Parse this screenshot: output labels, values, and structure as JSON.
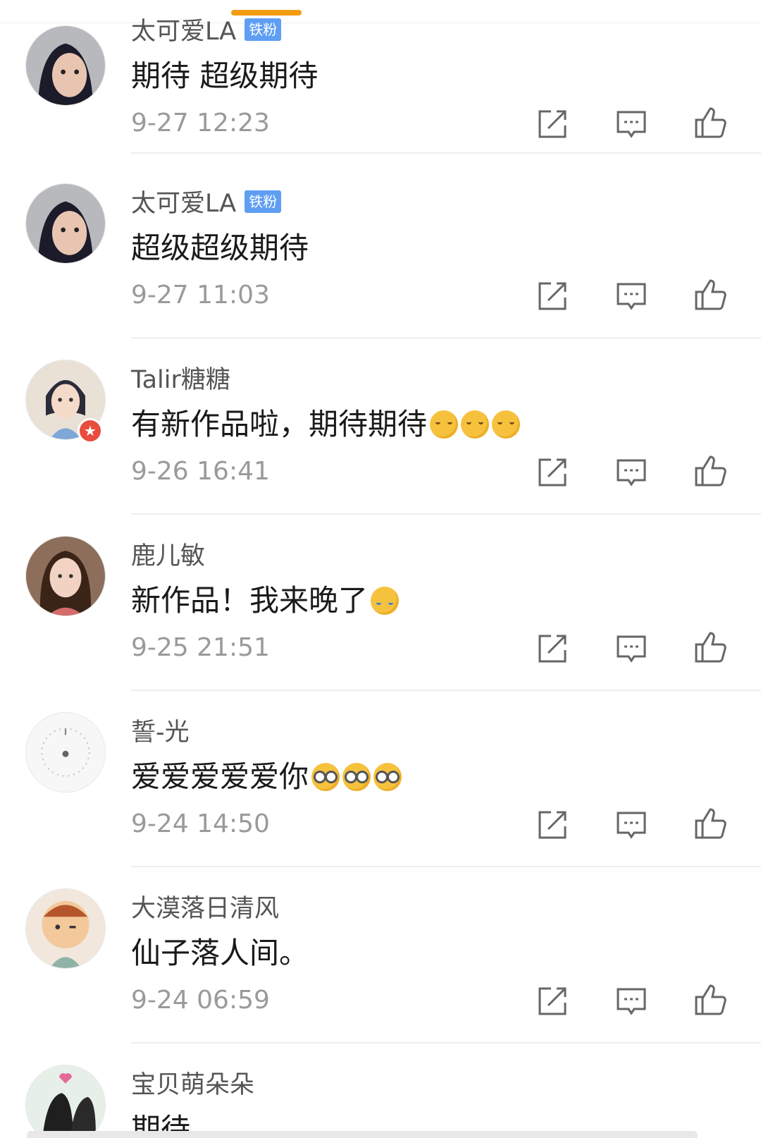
{
  "comments": [
    {
      "username": "太可爱LA",
      "badge": "铁粉",
      "text": "期待 超级期待",
      "emoji": [],
      "time": "9-27 12:23"
    },
    {
      "username": "太可爱LA",
      "badge": "铁粉",
      "text": "超级超级期待",
      "emoji": [],
      "time": "9-27 11:03"
    },
    {
      "username": "Talir糖糖",
      "badge": "",
      "text": "有新作品啦，期待期待",
      "emoji": [
        "blush-emoji",
        "blush-emoji",
        "blush-emoji"
      ],
      "time": "9-26 16:41",
      "verified": true
    },
    {
      "username": "鹿儿敏",
      "badge": "",
      "text": "新作品！我来晚了",
      "emoji": [
        "crying-emoji"
      ],
      "time": "9-25 21:51"
    },
    {
      "username": "誓-光",
      "badge": "",
      "text": "爱爱爱爱爱你",
      "emoji": [
        "nerd-emoji",
        "nerd-emoji",
        "nerd-emoji"
      ],
      "time": "9-24 14:50"
    },
    {
      "username": "大漠落日清风",
      "badge": "",
      "text": "仙子落人间。",
      "emoji": [],
      "time": "9-24 06:59"
    },
    {
      "username": "宝贝萌朵朵",
      "badge": "",
      "text": "期待",
      "emoji": [],
      "time": ""
    }
  ],
  "icons": {
    "share": "share-icon",
    "reply": "comment-icon",
    "like": "thumbs-up-icon"
  },
  "colors": {
    "tab_indicator": "#f39c12",
    "fan_badge": "#5f9ef2",
    "verified": "#e74c3c",
    "timestamp": "#9a9a9a"
  }
}
